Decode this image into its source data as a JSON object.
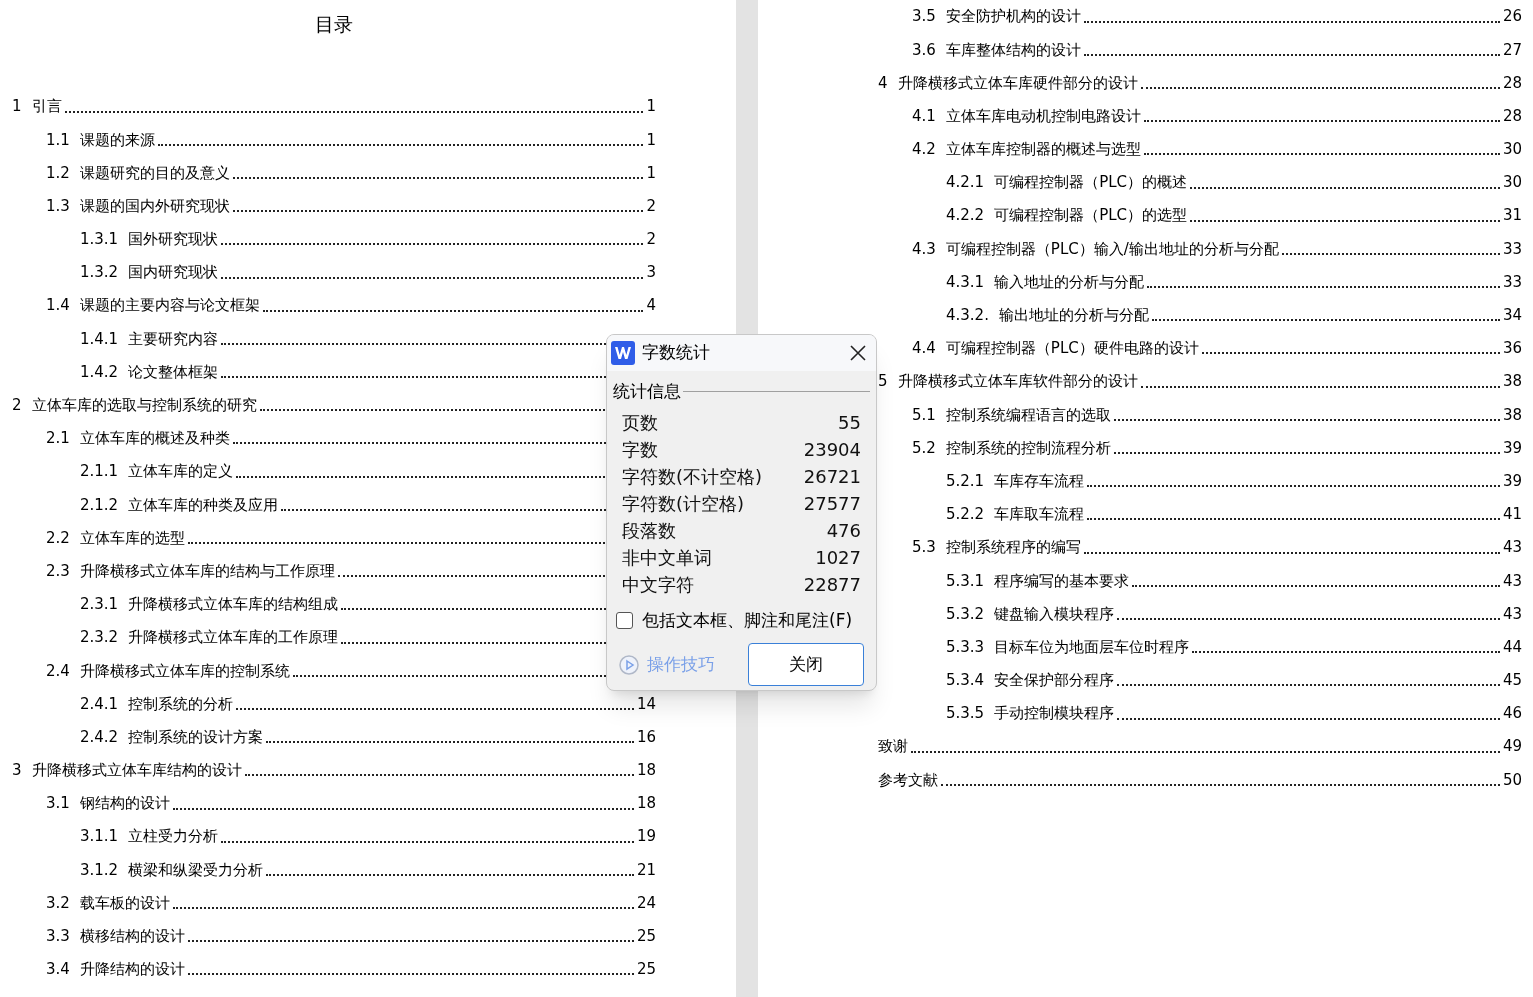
{
  "left_page": {
    "title": "目录",
    "entries": [
      {
        "number": "1",
        "title": "引言",
        "page": "1",
        "children": [
          {
            "number": "1.1",
            "title": "课题的来源",
            "page": "1"
          },
          {
            "number": "1.2",
            "title": "课题研究的目的及意义",
            "page": "1"
          },
          {
            "number": "1.3",
            "title": "课题的国内外研究现状",
            "page": "2",
            "children": [
              {
                "number": "1.3.1",
                "title": "国外研究现状",
                "page": "2"
              },
              {
                "number": "1.3.2",
                "title": "国内研究现状",
                "page": "3"
              }
            ]
          },
          {
            "number": "1.4",
            "title": "课题的主要内容与论文框架",
            "page": "4",
            "children": [
              {
                "number": "1.4.1",
                "title": "主要研究内容"
              },
              {
                "number": "1.4.2",
                "title": "论文整体框架"
              }
            ]
          }
        ]
      },
      {
        "number": "2",
        "title": "立体车库的选取与控制系统的研究",
        "children": [
          {
            "number": "2.1",
            "title": "立体车库的概述及种类",
            "children": [
              {
                "number": "2.1.1",
                "title": "立体车库的定义"
              },
              {
                "number": "2.1.2",
                "title": "立体车库的种类及应用"
              }
            ]
          },
          {
            "number": "2.2",
            "title": "立体车库的选型"
          },
          {
            "number": "2.3",
            "title": "升降横移式立体车库的结构与工作原理",
            "children": [
              {
                "number": "2.3.1",
                "title": "升降横移式立体车库的结构组成"
              },
              {
                "number": "2.3.2",
                "title": "升降横移式立体车库的工作原理"
              }
            ]
          },
          {
            "number": "2.4",
            "title": "升降横移式立体车库的控制系统",
            "children": [
              {
                "number": "2.4.1",
                "title": "控制系统的分析",
                "page": "14"
              },
              {
                "number": "2.4.2",
                "title": "控制系统的设计方案",
                "page": "16"
              }
            ]
          }
        ]
      },
      {
        "number": "3",
        "title": "升降横移式立体车库结构的设计",
        "page": "18",
        "children": [
          {
            "number": "3.1",
            "title": "钢结构的设计",
            "page": "18",
            "children": [
              {
                "number": "3.1.1",
                "title": "立柱受力分析",
                "page": "19"
              },
              {
                "number": "3.1.2",
                "title": "横梁和纵梁受力分析",
                "page": "21"
              }
            ]
          },
          {
            "number": "3.2",
            "title": "载车板的设计",
            "page": "24"
          },
          {
            "number": "3.3",
            "title": "横移结构的设计",
            "page": "25"
          },
          {
            "number": "3.4",
            "title": "升降结构的设计",
            "page": "25"
          }
        ]
      }
    ]
  },
  "right_page": {
    "entries": [
      {
        "children": [
          {
            "number": "3.5",
            "title": "安全防护机构的设计",
            "page": "26"
          },
          {
            "number": "3.6",
            "title": "车库整体结构的设计",
            "page": "27"
          }
        ]
      },
      {
        "number": "4",
        "title": "升降横移式立体车库硬件部分的设计",
        "page": "28",
        "children": [
          {
            "number": "4.1",
            "title": "立体车库电动机控制电路设计",
            "page": "28"
          },
          {
            "number": "4.2",
            "title": "立体车库控制器的概述与选型",
            "page": "30",
            "children": [
              {
                "number": "4.2.1",
                "title": "可编程控制器（PLC）的概述",
                "page": "30"
              },
              {
                "number": "4.2.2",
                "title": "可编程控制器（PLC）的选型",
                "page": "31"
              }
            ]
          },
          {
            "number": "4.3",
            "title": "可编程控制器（PLC）输入/输出地址的分析与分配",
            "page": "33",
            "children": [
              {
                "number": "4.3.1",
                "title": "输入地址的分析与分配",
                "page": "33"
              },
              {
                "number": "4.3.2.",
                "title": "输出地址的分析与分配",
                "page": "34"
              }
            ]
          },
          {
            "number": "4.4",
            "title": "可编程控制器（PLC）硬件电路的设计",
            "page": "36"
          }
        ]
      },
      {
        "number": "5",
        "title": "升降横移式立体车库软件部分的设计",
        "page": "38",
        "children": [
          {
            "number": "5.1",
            "title": "控制系统编程语言的选取",
            "page": "38"
          },
          {
            "number": "5.2",
            "title": "控制系统的控制流程分析",
            "page": "39",
            "children": [
              {
                "number": "5.2.1",
                "title": "车库存车流程",
                "page": "39"
              },
              {
                "number": "5.2.2",
                "title": "车库取车流程",
                "page": "41"
              }
            ]
          },
          {
            "number": "5.3",
            "title": "控制系统程序的编写",
            "page": "43",
            "children": [
              {
                "number": "5.3.1",
                "title": "程序编写的基本要求",
                "page": "43"
              },
              {
                "number": "5.3.2",
                "title": "键盘输入模块程序",
                "page": "43"
              },
              {
                "number": "5.3.3",
                "title": "目标车位为地面层车位时程序",
                "page": "44"
              },
              {
                "number": "5.3.4",
                "title": "安全保护部分程序",
                "page": "45"
              },
              {
                "number": "5.3.5",
                "title": "手动控制模块程序",
                "page": "46"
              }
            ]
          }
        ]
      },
      {
        "title": "致谢",
        "page": "49"
      },
      {
        "title": "参考文献",
        "page": "50"
      }
    ]
  },
  "dialog": {
    "title": "字数统计",
    "section": "统计信息",
    "stats": [
      {
        "label": "页数",
        "value": "55"
      },
      {
        "label": "字数",
        "value": "23904"
      },
      {
        "label": "字符数(不计空格)",
        "value": "26721"
      },
      {
        "label": "字符数(计空格)",
        "value": "27577"
      },
      {
        "label": "段落数",
        "value": "476"
      },
      {
        "label": "非中文单词",
        "value": "1027"
      },
      {
        "label": "中文字符",
        "value": "22877"
      }
    ],
    "checkbox": {
      "label": "包括文本框、脚注和尾注(F)",
      "checked": false
    },
    "tips_link": "操作技巧",
    "close_button": "关闭"
  }
}
